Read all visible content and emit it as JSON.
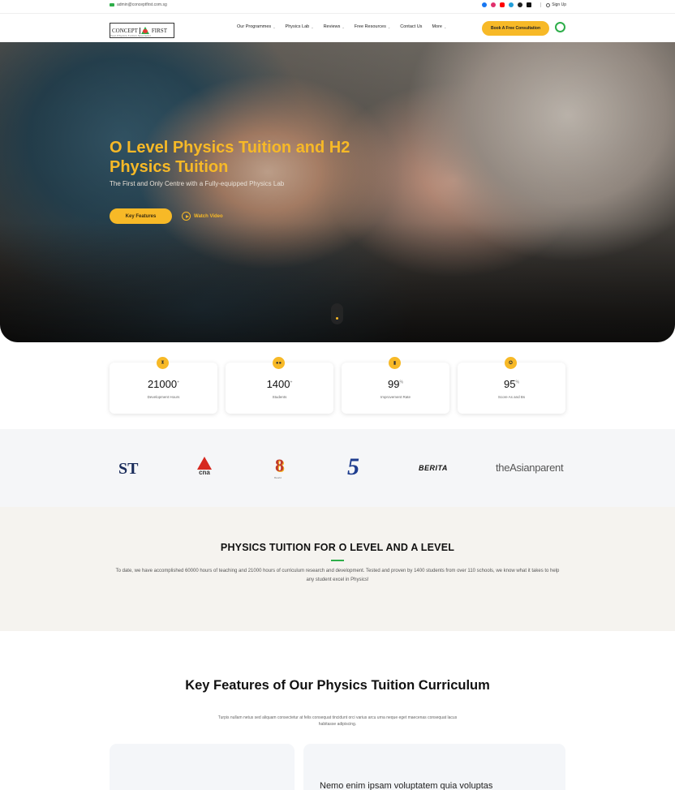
{
  "topbar": {
    "email": "admin@conceptfirst.com.sg",
    "signin": "Sign Up",
    "social_icons": [
      "facebook-icon",
      "instagram-icon",
      "youtube-icon",
      "telegram-icon",
      "medium-icon",
      "tiktok-icon"
    ]
  },
  "nav": {
    "logo_left": "CONCEPT",
    "logo_right": "FIRST",
    "logo_tagline": "Your Physics Tuition Specialist",
    "items": [
      "Our Programmes",
      "Physics Lab",
      "Reviews",
      "Free Resources",
      "Contact Us",
      "More"
    ],
    "cta": "Book A Free Consultation"
  },
  "hero": {
    "title": "O Level Physics Tuition and H2 Physics Tuition",
    "subtitle": "The First and Only Centre with a Fully-equipped Physics Lab",
    "primary_button": "Key Features",
    "secondary_button": "Watch Video"
  },
  "stats": [
    {
      "icon": "hourglass-icon",
      "value": "21000",
      "suffix": "+",
      "label": "Development Hours"
    },
    {
      "icon": "students-icon",
      "value": "1400",
      "suffix": "+",
      "label": "Students"
    },
    {
      "icon": "chart-icon",
      "value": "99",
      "suffix": "%",
      "label": "Improvement Rate"
    },
    {
      "icon": "award-icon",
      "value": "95",
      "suffix": "%",
      "label": "Score As and Bs"
    }
  ],
  "media_logos": {
    "st": "ST",
    "cna": "cna",
    "channel8": "8",
    "channel8_sub": "8world",
    "channel5": "5",
    "berita": "BERITA",
    "tap": "theAsianparent"
  },
  "physics_section": {
    "title": "PHYSICS TUITION FOR O LEVEL AND A LEVEL",
    "text": "To date, we have accomplished 60000 hours of teaching and 21000 hours of curriculum research and development. Tested and proven by 1400 students from over 110 schools, we know what it takes to help any student excel in Physics!"
  },
  "key_features": {
    "title": "Key Features of Our Physics Tuition Curriculum",
    "subtitle": "Turpis nullam netus sed aliquam consectetur at felis consequat tincidunt orci varius arcu urna neque eget maecenas consequat lacus habitasse adipiscing.",
    "card_text": "Nemo enim ipsam voluptatem quia voluptas"
  },
  "colors": {
    "accent": "#f7b927",
    "green": "#2eae4a"
  }
}
